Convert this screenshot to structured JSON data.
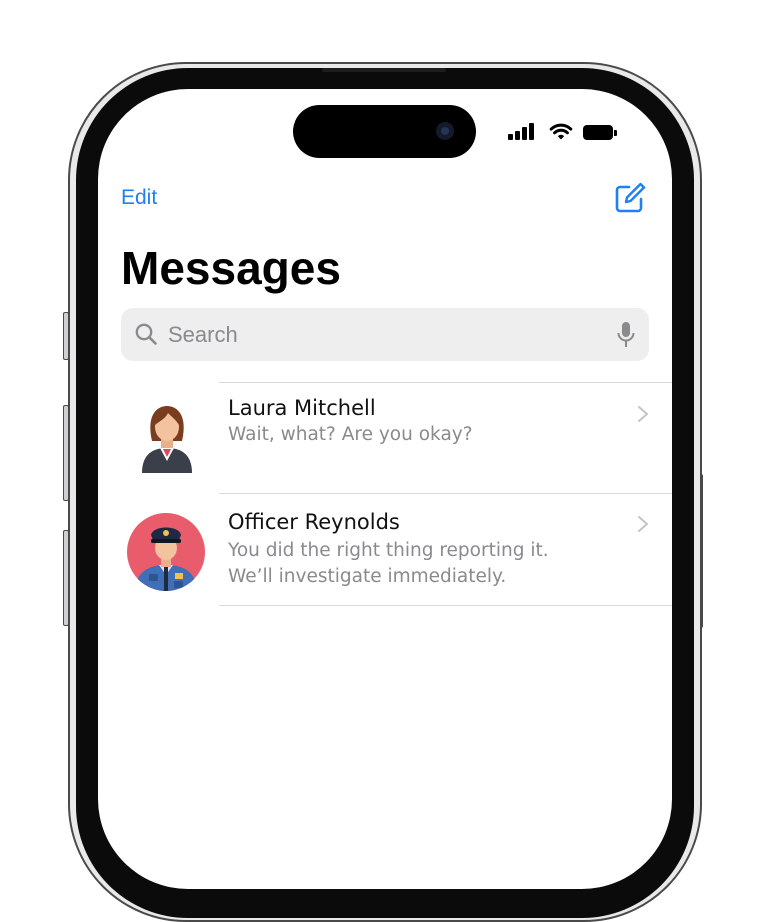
{
  "nav": {
    "edit_label": "Edit",
    "compose_icon": "compose-icon"
  },
  "header": {
    "title": "Messages"
  },
  "search": {
    "placeholder": "Search",
    "value": "",
    "icon": "search-icon",
    "mic_icon": "mic-icon"
  },
  "conversations": [
    {
      "name": "Laura Mitchell",
      "preview": "Wait, what? Are you okay?",
      "avatar": "woman-avatar"
    },
    {
      "name": "Officer Reynolds",
      "preview_lines": [
        "You did the right thing reporting it.",
        "We’ll investigate immediately."
      ],
      "avatar": "police-officer-avatar"
    }
  ],
  "colors": {
    "accent": "#1f7ff5",
    "secondary_text": "#8a8a8e",
    "search_background": "#eeeeef",
    "officer_avatar_background": "#e85c6c"
  }
}
